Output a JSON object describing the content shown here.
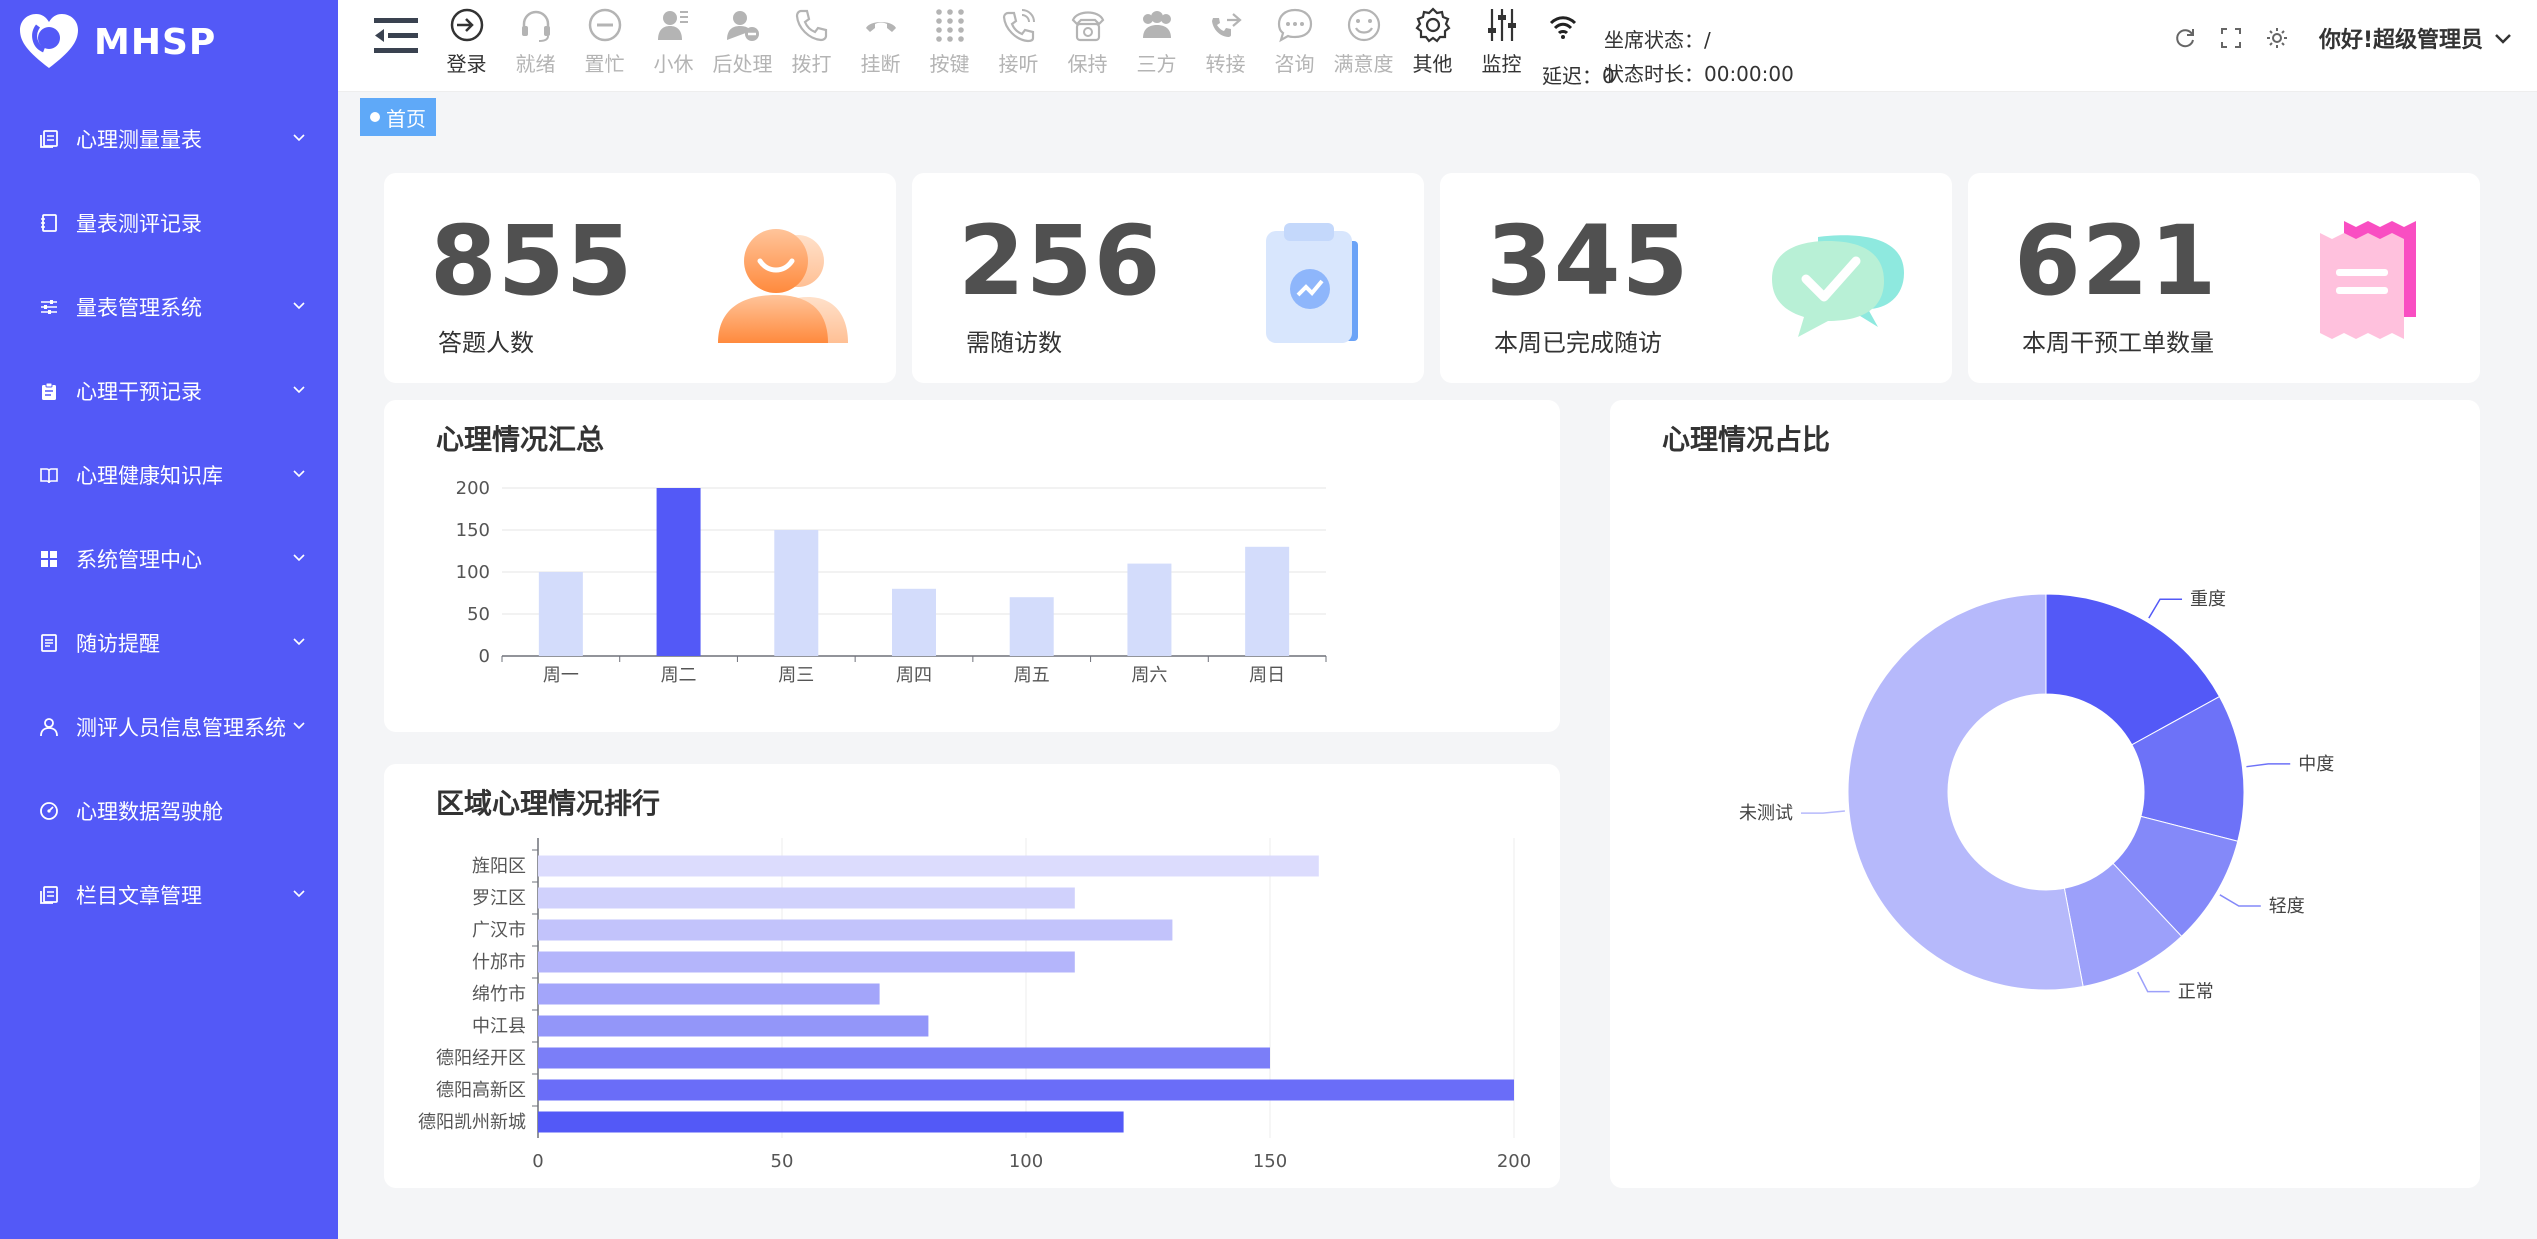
{
  "app": {
    "logo_text": "MHSP",
    "accent": "#5359f7"
  },
  "sidebar": {
    "items": [
      {
        "label": "心理测量量表",
        "icon": "copy-icon",
        "has_children": true
      },
      {
        "label": "量表测评记录",
        "icon": "notebook-icon",
        "has_children": false
      },
      {
        "label": "量表管理系统",
        "icon": "sliders-icon",
        "has_children": true
      },
      {
        "label": "心理干预记录",
        "icon": "clipboard-icon",
        "has_children": true
      },
      {
        "label": "心理健康知识库",
        "icon": "book-icon",
        "has_children": true
      },
      {
        "label": "系统管理中心",
        "icon": "grid-icon",
        "has_children": true
      },
      {
        "label": "随访提醒",
        "icon": "document-icon",
        "has_children": true
      },
      {
        "label": "测评人员信息管理系统",
        "icon": "user-icon",
        "has_children": true
      },
      {
        "label": "心理数据驾驶舱",
        "icon": "gauge-icon",
        "has_children": false
      },
      {
        "label": "栏目文章管理",
        "icon": "copy-icon",
        "has_children": true
      }
    ]
  },
  "toolbar": {
    "tools": [
      {
        "label": "登录",
        "icon": "login-icon",
        "active": true
      },
      {
        "label": "就绪",
        "icon": "headset-icon",
        "active": false
      },
      {
        "label": "置忙",
        "icon": "busy-icon",
        "active": false
      },
      {
        "label": "小休",
        "icon": "rest-icon",
        "active": false
      },
      {
        "label": "后处理",
        "icon": "after-call-icon",
        "active": false
      },
      {
        "label": "拨打",
        "icon": "phone-icon",
        "active": false
      },
      {
        "label": "挂断",
        "icon": "hangup-icon",
        "active": false
      },
      {
        "label": "按键",
        "icon": "keypad-icon",
        "active": false
      },
      {
        "label": "接听",
        "icon": "answer-icon",
        "active": false
      },
      {
        "label": "保持",
        "icon": "hold-icon",
        "active": false
      },
      {
        "label": "三方",
        "icon": "conference-icon",
        "active": false
      },
      {
        "label": "转接",
        "icon": "transfer-icon",
        "active": false
      },
      {
        "label": "咨询",
        "icon": "chat-icon",
        "active": false
      },
      {
        "label": "满意度",
        "icon": "smile-icon",
        "active": false
      },
      {
        "label": "其他",
        "icon": "gear-icon",
        "active": true
      },
      {
        "label": "监控",
        "icon": "monitor-icon",
        "active": true
      }
    ]
  },
  "status": {
    "latency_label": "延迟：0",
    "seat_status": "坐席状态：/",
    "status_duration": "状态时长：00:00:00"
  },
  "header": {
    "greeting": "你好!超级管理员"
  },
  "breadcrumb": {
    "home": "首页"
  },
  "stats": [
    {
      "value": "855",
      "label": "答题人数",
      "icon": "person-illustration"
    },
    {
      "value": "256",
      "label": "需随访数",
      "icon": "clipboard-illustration"
    },
    {
      "value": "345",
      "label": "本周已完成随访",
      "icon": "check-chat-illustration"
    },
    {
      "value": "621",
      "label": "本周干预工单数量",
      "icon": "receipt-illustration"
    }
  ],
  "panels": {
    "summary_title": "心理情况汇总",
    "region_title": "区域心理情况排行",
    "ratio_title": "心理情况占比"
  },
  "chart_data": [
    {
      "type": "bar",
      "title": "心理情况汇总",
      "categories": [
        "周一",
        "周二",
        "周三",
        "周四",
        "周五",
        "周六",
        "周日"
      ],
      "values": [
        100,
        200,
        150,
        80,
        70,
        110,
        130
      ],
      "highlight_index": 1,
      "ylim": [
        0,
        200
      ],
      "yticks": [
        0,
        50,
        100,
        150,
        200
      ],
      "colors": {
        "bar": "#d3dcfb",
        "highlight": "#5359f7"
      }
    },
    {
      "type": "bar",
      "orientation": "horizontal",
      "title": "区域心理情况排行",
      "categories": [
        "旌阳区",
        "罗江区",
        "广汉市",
        "什邡市",
        "绵竹市",
        "中江县",
        "德阳经开区",
        "德阳高新区",
        "德阳凯州新城"
      ],
      "values": [
        160,
        110,
        130,
        110,
        70,
        80,
        150,
        200,
        120
      ],
      "xlim": [
        0,
        200
      ],
      "xticks": [
        0,
        50,
        100,
        150,
        200
      ],
      "colors": [
        "#dcdcfd",
        "#d0d1fc",
        "#c2c3fb",
        "#b4b5fb",
        "#a3a5fa",
        "#9396f9",
        "#7b7ef8",
        "#6a6df8",
        "#5359f7"
      ]
    },
    {
      "type": "pie",
      "donut": true,
      "title": "心理情况占比",
      "slices": [
        {
          "name": "重度",
          "value": 17,
          "color": "#5359f7"
        },
        {
          "name": "中度",
          "value": 12,
          "color": "#6d72f8"
        },
        {
          "name": "轻度",
          "value": 9,
          "color": "#8489f9"
        },
        {
          "name": "正常",
          "value": 9,
          "color": "#9ca0fa"
        },
        {
          "name": "未测试",
          "value": 53,
          "color": "#b6b9fb"
        }
      ]
    }
  ]
}
